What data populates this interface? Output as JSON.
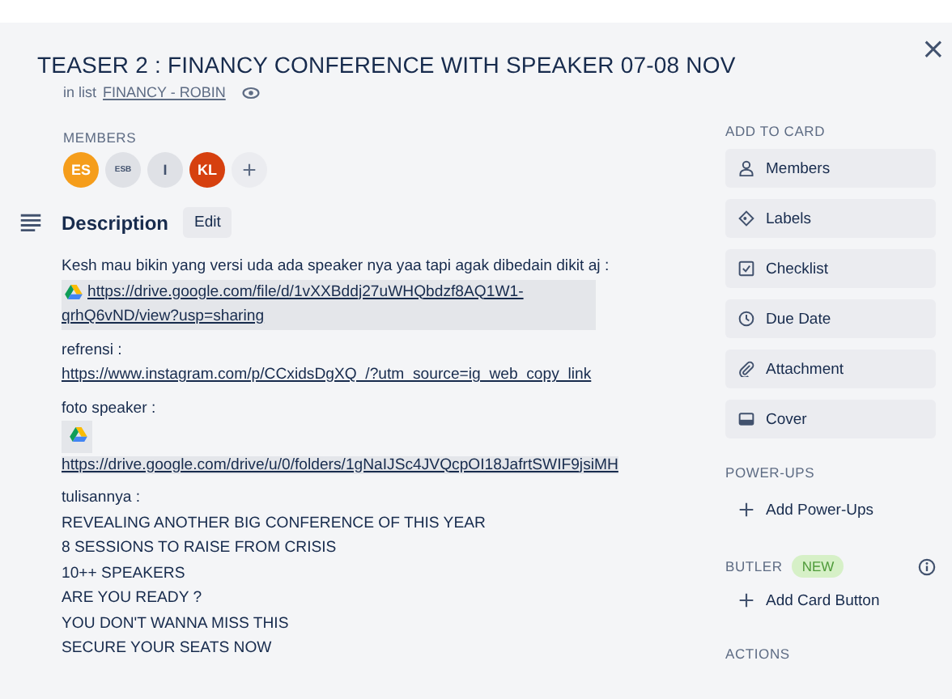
{
  "card": {
    "title": "TEASER 2 : FINANCY CONFERENCE WITH SPEAKER 07-08 NOV",
    "list_prefix": "in list",
    "list_name": "FINANCY - ROBIN",
    "close": "×"
  },
  "members": {
    "label": "MEMBERS",
    "items": [
      {
        "initials": "ES",
        "color": "#f59d1b"
      },
      {
        "initials": "ESB",
        "color": "#dfe1e6"
      },
      {
        "initials": "I",
        "color": "#dfe1e6"
      },
      {
        "initials": "KL",
        "color": "#d6400f"
      }
    ],
    "add": "+"
  },
  "description": {
    "title": "Description",
    "edit": "Edit",
    "blocks": [
      {
        "kind": "text",
        "text": "Kesh mau bikin yang versi uda ada speaker nya yaa tapi agak dibedain dikit aj :"
      },
      {
        "kind": "drive_link",
        "text": "https://drive.google.com/file/d/1vXXBddj27uWHQbdzf8AQ1W1-qrhQ6vND/view?usp=sharing"
      },
      {
        "kind": "gap"
      },
      {
        "kind": "text",
        "text": "refrensi :"
      },
      {
        "kind": "link",
        "text": "https://www.instagram.com/p/CCxidsDgXQ_/?utm_source=ig_web_copy_link"
      },
      {
        "kind": "gap"
      },
      {
        "kind": "text",
        "text": "foto speaker :"
      },
      {
        "kind": "drive_icon"
      },
      {
        "kind": "drive_link_plain",
        "text": "https://drive.google.com/drive/u/0/folders/1gNaIJSc4JVQcpOI18JafrtSWIF9jsiMH"
      },
      {
        "kind": "gap"
      },
      {
        "kind": "text",
        "text": "tulisannya :"
      },
      {
        "kind": "text",
        "text": "REVEALING ANOTHER BIG CONFERENCE OF THIS YEAR"
      },
      {
        "kind": "text",
        "text": "8 SESSIONS TO RAISE FROM CRISIS"
      },
      {
        "kind": "text",
        "text": "10++ SPEAKERS"
      },
      {
        "kind": "text",
        "text": "ARE YOU READY ?"
      },
      {
        "kind": "text",
        "text": "YOU DON'T WANNA MISS THIS"
      },
      {
        "kind": "text",
        "text": "SECURE YOUR SEATS NOW"
      }
    ]
  },
  "sidebar": {
    "add_to_card": {
      "label": "ADD TO CARD",
      "buttons": [
        {
          "label": "Members",
          "kind": "members"
        },
        {
          "label": "Labels",
          "kind": "labels"
        },
        {
          "label": "Checklist",
          "kind": "checklist"
        },
        {
          "label": "Due Date",
          "kind": "due_date"
        },
        {
          "label": "Attachment",
          "kind": "attachment"
        },
        {
          "label": "Cover",
          "kind": "cover"
        }
      ]
    },
    "power_ups": {
      "label": "POWER-UPS",
      "button": "Add Power-Ups"
    },
    "butler": {
      "label": "BUTLER",
      "badge": "NEW",
      "button": "Add Card Button"
    },
    "actions": {
      "label": "ACTIONS"
    }
  }
}
